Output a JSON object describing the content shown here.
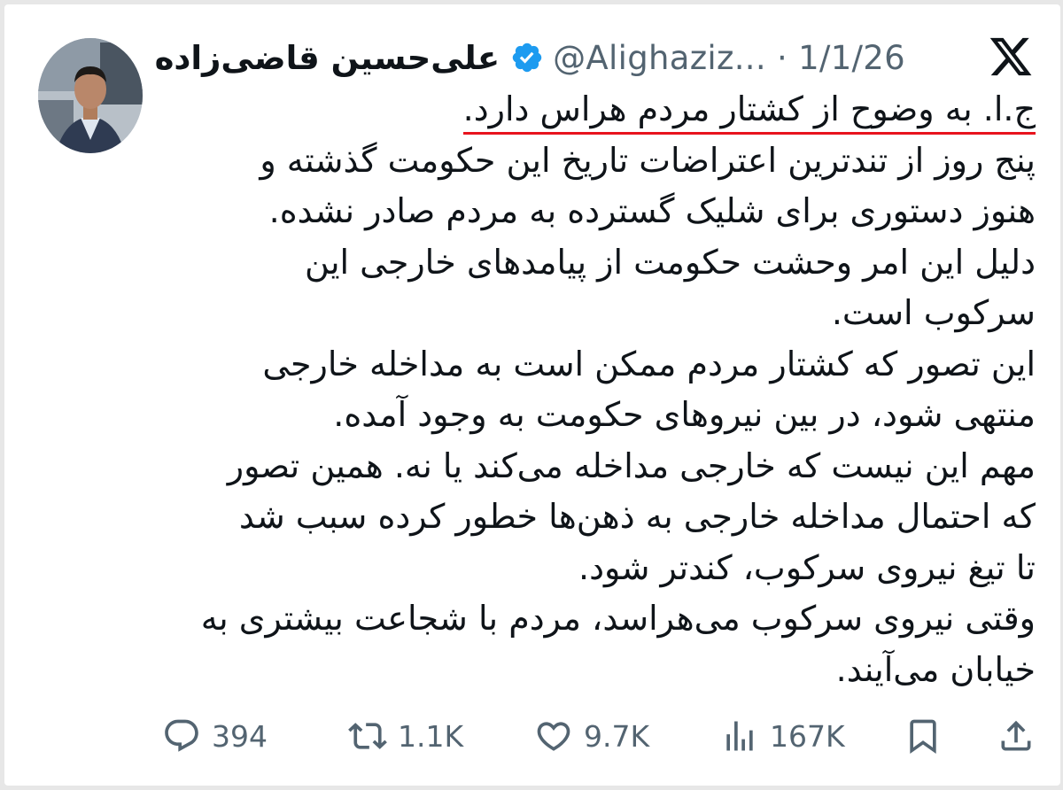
{
  "author": {
    "display_name": "علی‌حسین قاضی‌زاده",
    "handle_meta": "@Alighaziz... · 1/1/26",
    "verified": true,
    "verified_color": "#1d9bf0"
  },
  "tweet": {
    "headline": "ج.ا. به وضوح از کشتار مردم هراس دارد.",
    "lines": [
      "پنج روز از تندترین اعتراضات تاریخ این حکومت گذشته و",
      "هنوز دستوری برای شلیک گسترده به مردم صادر نشده.",
      "دلیل این امر وحشت حکومت از پیامدهای خارجی این",
      "سرکوب است.",
      "این تصور که کشتار مردم ممکن است به مداخله خارجی",
      "منتهی شود، در بین نیروهای حکومت به وجود آمده.",
      "مهم این نیست که خارجی مداخله می‌کند یا نه. همین تصور",
      "که احتمال مداخله خارجی به ذهن‌ها خطور کرده سبب شد",
      "تا تیغ نیروی سرکوب، کندتر شود.",
      "وقتی نیروی سرکوب می‌هراسد، مردم با شجاعت بیشتری به",
      "خیابان می‌آیند."
    ],
    "headline_underline_color": "#e8131d"
  },
  "actions": {
    "replies": {
      "icon": "reply-icon",
      "count": "394"
    },
    "reposts": {
      "icon": "repost-icon",
      "count": "1.1K"
    },
    "likes": {
      "icon": "heart-icon",
      "count": "9.7K"
    },
    "views": {
      "icon": "views-icon",
      "count": "167K"
    },
    "bookmark": {
      "icon": "bookmark-icon"
    },
    "share": {
      "icon": "share-icon"
    }
  },
  "branding": {
    "logo": "x-logo-icon"
  }
}
